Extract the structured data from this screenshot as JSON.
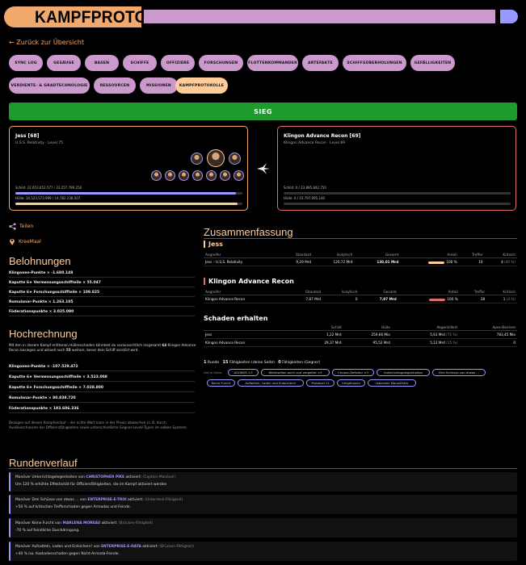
{
  "header": {
    "title": "KAMPFPROTOKOLL"
  },
  "back": {
    "label": "← Zurück zur Übersicht"
  },
  "nav": [
    {
      "label": "Sync Log",
      "active": false
    },
    {
      "label": "Gesäuge",
      "active": false
    },
    {
      "label": "Basen",
      "active": false
    },
    {
      "label": "Schiffe",
      "active": false
    },
    {
      "label": "Offiziere",
      "active": false
    },
    {
      "label": "Forschungen",
      "active": false
    },
    {
      "label": "Flottenkommander",
      "active": false
    },
    {
      "label": "Artefakte",
      "active": false
    },
    {
      "label": "Schiffsüberholungen",
      "active": false
    },
    {
      "label": "Gefälligkeiten",
      "active": false
    },
    {
      "label": "Verdiente- & Gradtechnologie",
      "active": false
    },
    {
      "label": "Ressourcen",
      "active": false
    },
    {
      "label": "Missionen",
      "active": false
    },
    {
      "label": "Kampfprotokolle",
      "active": true
    }
  ],
  "result": {
    "label": "SIEG"
  },
  "left_fleet": {
    "name": "Jess [68]",
    "sub": "U.S.S. Relativity · Level 75",
    "shield": "Schild: 22.653.652.577 / 23.257.790.250",
    "hull": "Hülle: 14.523.573.999 / 14.782.238.507",
    "shield_pct": 0.97,
    "hull_pct": 0.98
  },
  "right_fleet": {
    "name": "Klingon Advance Recon [69]",
    "sub": "Klingon Advance Recon · Level 69",
    "shield": "Schild: 0 / 23.895.842.750",
    "hull": "Hülle: 0 / 15.797.095.140",
    "shield_pct": 0,
    "hull_pct": 0
  },
  "share": {
    "label": "Teilen"
  },
  "location": {
    "label": "KreeMaal"
  },
  "rewards": {
    "title": "Belohnungen",
    "items": [
      "Klingonen-Punkte × -1.680.148",
      "Kaputte 6★ Vermessungsschiffteile × 55.047",
      "Kaputte 6★ Forschungsschiffteile × 109.825",
      "Romulanar-Punkte × 1.263.105",
      "Föderationspunkte × 3.025.090"
    ]
  },
  "projection": {
    "title": "Hochrechnung",
    "intro_pre": "Mit den in diesem Kampf erlittenen Hüllenschaden könntest du voraussichtlich insgesamt ",
    "intro_num": "64",
    "intro_mid": " Klingon Advance Recon besiegen und aktuell noch ",
    "intro_num2": "55",
    "intro_post": " weitere, bevor dein Schiff zerstört wird.",
    "items": [
      "Klingonen-Punkte × -107.529.472",
      "Kaputte 6★ Vermessungsschiffteile × 3.523.008",
      "Kaputte 6★ Forschungsschiffteile × 7.028.800",
      "Romulanar-Punkte × 80.838.720",
      "Föderationspunkte × 193.606.336"
    ],
    "note": "Bezogen auf diesen Kampfverlauf – der echte Wert kann in der Praxis abweichen (z. B. durch Auslöseschancen der Offiziersfähigkeiten sowie unterschiedliche Gegner-Level/-Typen im selben System)."
  },
  "summary": {
    "title": "Zusammenfassung",
    "jess": {
      "title": "Jess",
      "headers": [
        "Angreifer",
        "Standard",
        "Isolytisch",
        "Gesamt",
        "Anteil",
        "Treffer",
        "Kritisch"
      ],
      "rows": [
        {
          "name": "Jess – U.S.S. Relativity",
          "standard": "9,29 Mrd",
          "iso": "120,72 Mrd",
          "total": "130,01 Mrd",
          "share": "100 %",
          "share_frac": 1.0,
          "hits": "10",
          "crit": "4",
          "crit_pct": "(40 %)"
        }
      ]
    },
    "klingon": {
      "title": "Klingon Advance Recon",
      "headers": [
        "Angreifer",
        "Standard",
        "Isolytisch",
        "Gesamt",
        "Anteil",
        "Treffer",
        "Kritisch"
      ],
      "rows": [
        {
          "name": "Klingon Advance Recon",
          "standard": "7,87 Mrd",
          "iso": "0",
          "total": "7,87 Mrd",
          "share": "100 %",
          "share_frac": 1.0,
          "hits": "28",
          "crit": "1",
          "crit_pct": "(4 %)"
        }
      ]
    },
    "received": {
      "title": "Schaden erhalten",
      "headers": [
        "",
        "Schild",
        "Hülle",
        "Abgemildert",
        "Apex-Barriere"
      ],
      "rows": [
        {
          "name": "Jess",
          "shield": "1,22 Mrd",
          "hull": "259,66 Mio",
          "mit": "5,61 Mrd",
          "mit_pct": "(71 %)",
          "apex": "783,45 Mio"
        },
        {
          "name": "Klingon Advance Recon",
          "shield": "29,37 Mrd",
          "hull": "95,52 Mrd",
          "mit": "5,12 Mrd",
          "mit_pct": "(15 %)",
          "apex": "0"
        }
      ]
    },
    "stats": {
      "rounds": "1",
      "rounds_label": "Runde",
      "own": "15",
      "own_label": "Fähigkeiten (deine Seite)",
      "enemy": "0",
      "enemy_label": "Fähigkeiten (Gegner)"
    },
    "tags_label": "Deine Seite:",
    "tags": [
      "AGONUS ×3",
      "Widerwillen auch und vergeltet ×3",
      "Chrono-Defizitor ×3",
      "Unterrichtsgelegenheiten",
      "Drei Schüsse von etwas ...",
      "Keine Furcht",
      "Aufbellen, Laden und Entsichern!",
      "Protokoll 12",
      "Umgehauen",
      "Lebender Monolithter"
    ]
  },
  "rounds": {
    "title": "Rundenverlauf",
    "items": [
      {
        "pre": "Manöver Unterrichtsgelegenheiten von ",
        "who": "CHRISTOPHER PIKE",
        "post": " aktiviert:",
        "kind": "(Captain-Manöver)",
        "desc": "Um 120 % erhöhte Effektivität für Offiziersfähigkeiten, die im Kampf aktiviert werden"
      },
      {
        "pre": "Manöver Drei Schüsse von etwas … von ",
        "who": "ENTERPRISE-E-TROI",
        "post": " aktiviert:",
        "kind": "(Unterdeck-Fähigkeit)",
        "desc": "+50 % auf kritischen Trefferschaden gegen Armadas und Feinde."
      },
      {
        "pre": "Manöver Keine Furcht von ",
        "who": "MARLENA MOREAU",
        "post": " aktiviert:",
        "kind": "(Brücken-Fähigkeit)",
        "desc": "-70 % auf feindliche Durchdringung."
      },
      {
        "pre": "Manöver Aufsatteln, Laden und Entsichern! von ",
        "who": "ENTERPRISE-E-DATA",
        "post": " aktiviert:",
        "kind": "(Brücken-Fähigkeit)",
        "desc": "+40 % iso. Kaskadenschaden gegen Nicht-Armada-Feinde."
      }
    ]
  },
  "colors": {
    "accent": "#f2a96e",
    "lilac": "#cc99cc",
    "blue": "#9999ff",
    "win": "#1f9a2e",
    "enemy": "#e06c6c"
  }
}
